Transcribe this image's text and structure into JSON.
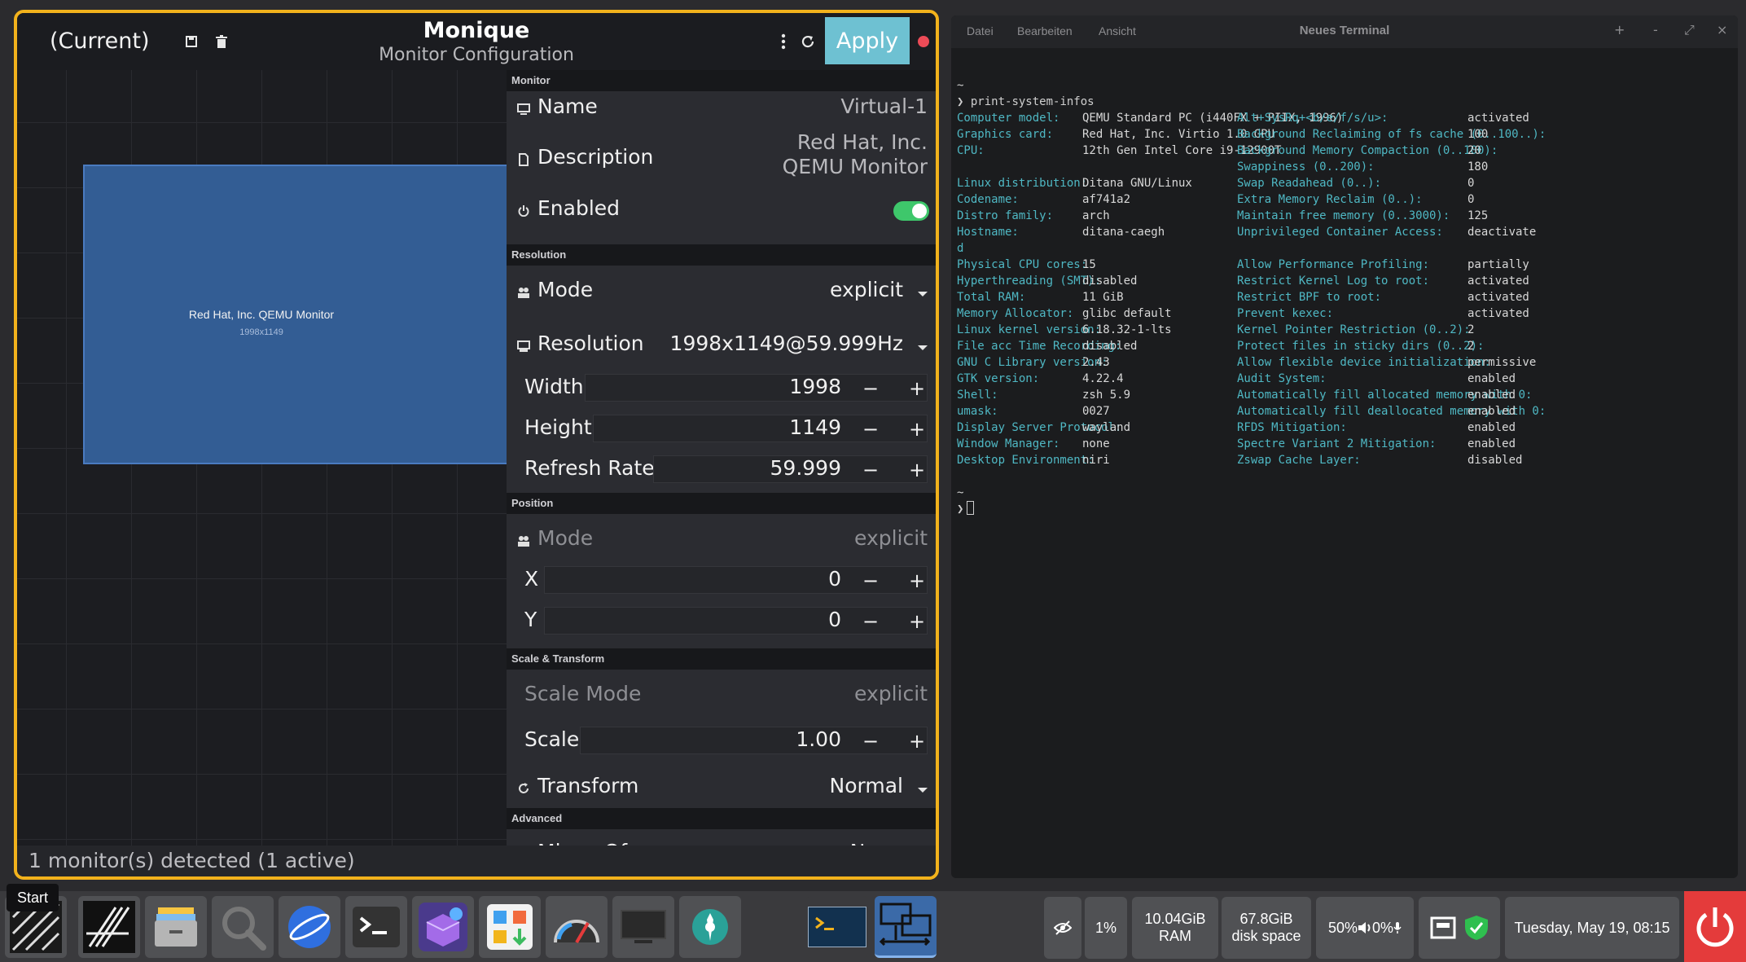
{
  "monique": {
    "profile": "(Current)",
    "title": "Monique",
    "subtitle": "Monitor Configuration",
    "apply_label": "Apply",
    "canvas": {
      "monitor_name": "Red Hat, Inc. QEMU Monitor",
      "monitor_res": "1998x1149"
    },
    "sections": {
      "monitor": "Monitor",
      "resolution": "Resolution",
      "position": "Position",
      "scale": "Scale & Transform",
      "advanced": "Advanced"
    },
    "monitor": {
      "name_label": "Name",
      "name_value": "Virtual-1",
      "desc_label": "Description",
      "desc_line1": "Red Hat, Inc.",
      "desc_line2": "QEMU Monitor",
      "enabled_label": "Enabled",
      "enabled": true
    },
    "resolution": {
      "mode_label": "Mode",
      "mode_value": "explicit",
      "res_label": "Resolution",
      "res_value": "1998x1149@59.999Hz",
      "width_label": "Width",
      "width_value": "1998",
      "height_label": "Height",
      "height_value": "1149",
      "refresh_label": "Refresh Rate",
      "refresh_value": "59.999"
    },
    "position": {
      "mode_label": "Mode",
      "mode_value": "explicit",
      "x_label": "X",
      "x_value": "0",
      "y_label": "Y",
      "y_value": "0"
    },
    "scale": {
      "scale_mode_label": "Scale Mode",
      "scale_mode_value": "explicit",
      "scale_label": "Scale",
      "scale_value": "1.00",
      "transform_label": "Transform",
      "transform_value": "Normal"
    },
    "advanced_partial": "Mirror Of",
    "advanced_partial_value": "None",
    "status": "1 monitor(s) detected (1 active)",
    "minus": "−",
    "plus": "+"
  },
  "terminal": {
    "menu": [
      "Datei",
      "Bearbeiten",
      "Ansicht"
    ],
    "title": "Neues Terminal",
    "controls": [
      "+",
      "-",
      "⤢",
      "×"
    ],
    "prompt_dir": "~",
    "prompt_symbol": "❯",
    "command": "print-system-infos",
    "left": [
      [
        "Computer model:",
        "QEMU Standard PC (i440FX + PIIX, 1996)"
      ],
      [
        "Graphics card:",
        "Red Hat, Inc. Virtio 1.0 GPU"
      ],
      [
        "CPU:",
        "12th Gen Intel Core i9-12900T"
      ],
      [
        "",
        ""
      ],
      [
        "Linux distribution:",
        "Ditana GNU/Linux"
      ],
      [
        "Codename:",
        "af741a2"
      ],
      [
        "Distro family:",
        "arch"
      ],
      [
        "Hostname:",
        "ditana-caegh"
      ],
      [
        "d",
        ""
      ],
      [
        "Physical CPU cores:",
        "15"
      ],
      [
        "Hyperthreading (SMT):",
        "disabled"
      ],
      [
        "Total RAM:",
        "11 GiB"
      ],
      [
        "Memory Allocator:",
        "glibc default"
      ],
      [
        "Linux kernel version:",
        "6.18.32-1-lts"
      ],
      [
        "File acc Time Recording:",
        "disabled"
      ],
      [
        "GNU C Library version:",
        "2.43"
      ],
      [
        "GTK version:",
        "4.22.4"
      ],
      [
        "Shell:",
        "zsh 5.9"
      ],
      [
        "umask:",
        "0027"
      ],
      [
        "Display Server Protocol:",
        "wayland"
      ],
      [
        "Window Manager:",
        "none"
      ],
      [
        "Desktop Environment:",
        "niri"
      ]
    ],
    "right": [
      [
        "Alt+SysRq+<b/e/f/s/u>:",
        "activated"
      ],
      [
        "Background Reclaiming of fs cache (0..100..):",
        "100"
      ],
      [
        "Background Memory Compaction (0..100):",
        "20"
      ],
      [
        "Swappiness (0..200):",
        "180"
      ],
      [
        "Swap Readahead (0..):",
        "0"
      ],
      [
        "Extra Memory Reclaim (0..):",
        "0"
      ],
      [
        "Maintain free memory (0..3000):",
        "125"
      ],
      [
        "Unprivileged Container Access:",
        "deactivate"
      ],
      [
        "",
        ""
      ],
      [
        "Allow Performance Profiling:",
        "partially"
      ],
      [
        "Restrict Kernel Log to root:",
        "activated"
      ],
      [
        "Restrict BPF to root:",
        "activated"
      ],
      [
        "Prevent kexec:",
        "activated"
      ],
      [
        "Kernel Pointer Restriction (0..2):",
        "2"
      ],
      [
        "Protect files in sticky dirs (0..2):",
        "2"
      ],
      [
        "Allow flexible device initialization:",
        "permissive"
      ],
      [
        "Audit System:",
        "enabled"
      ],
      [
        "Automatically fill allocated memory with 0:",
        "enabled"
      ],
      [
        "Automatically fill deallocated memory with 0:",
        "enabled"
      ],
      [
        "RFDS Mitigation:",
        "enabled"
      ],
      [
        "Spectre Variant 2 Mitigation:",
        "enabled"
      ],
      [
        "Zswap Cache Layer:",
        "disabled"
      ]
    ]
  },
  "taskbar": {
    "start_tooltip": "Start",
    "cpu": "1%",
    "ram_line1": "10.04GiB",
    "ram_line2": "RAM",
    "disk_line1": "67.8GiB",
    "disk_line2": "disk space",
    "volume": "50%",
    "mic": "0%",
    "datetime": "Tuesday, May 19, 08:15",
    "apps": [
      "start-menu",
      "ditana-logo",
      "file-manager",
      "search",
      "browser",
      "terminal",
      "package-manager",
      "software-center",
      "system-monitor",
      "display",
      "settings"
    ],
    "colors": {
      "accent_border": "#f2b21c",
      "apply": "#6ec1d2",
      "toggle_on": "#3ec76b",
      "power": "#e43b3b"
    }
  }
}
